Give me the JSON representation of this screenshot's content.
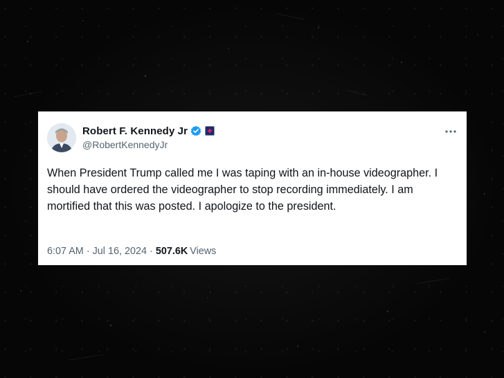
{
  "tweet": {
    "display_name": "Robert F. Kennedy Jr",
    "handle": "@RobertKennedyJr",
    "text": "When President Trump called me I was taping with an in-house videographer. I should have ordered the videographer to stop recording immediately. I am mortified that this was posted. I apologize to the president.",
    "time": "6:07 AM",
    "separator": "·",
    "date": "Jul 16, 2024",
    "views_count": "507.6K",
    "views_label": "Views",
    "icons": [
      "verified-icon",
      "affiliation-badge-icon",
      "more-icon"
    ],
    "colors": {
      "verified": "#1d9bf0",
      "text": "#0f1419",
      "secondary": "#536471"
    }
  }
}
